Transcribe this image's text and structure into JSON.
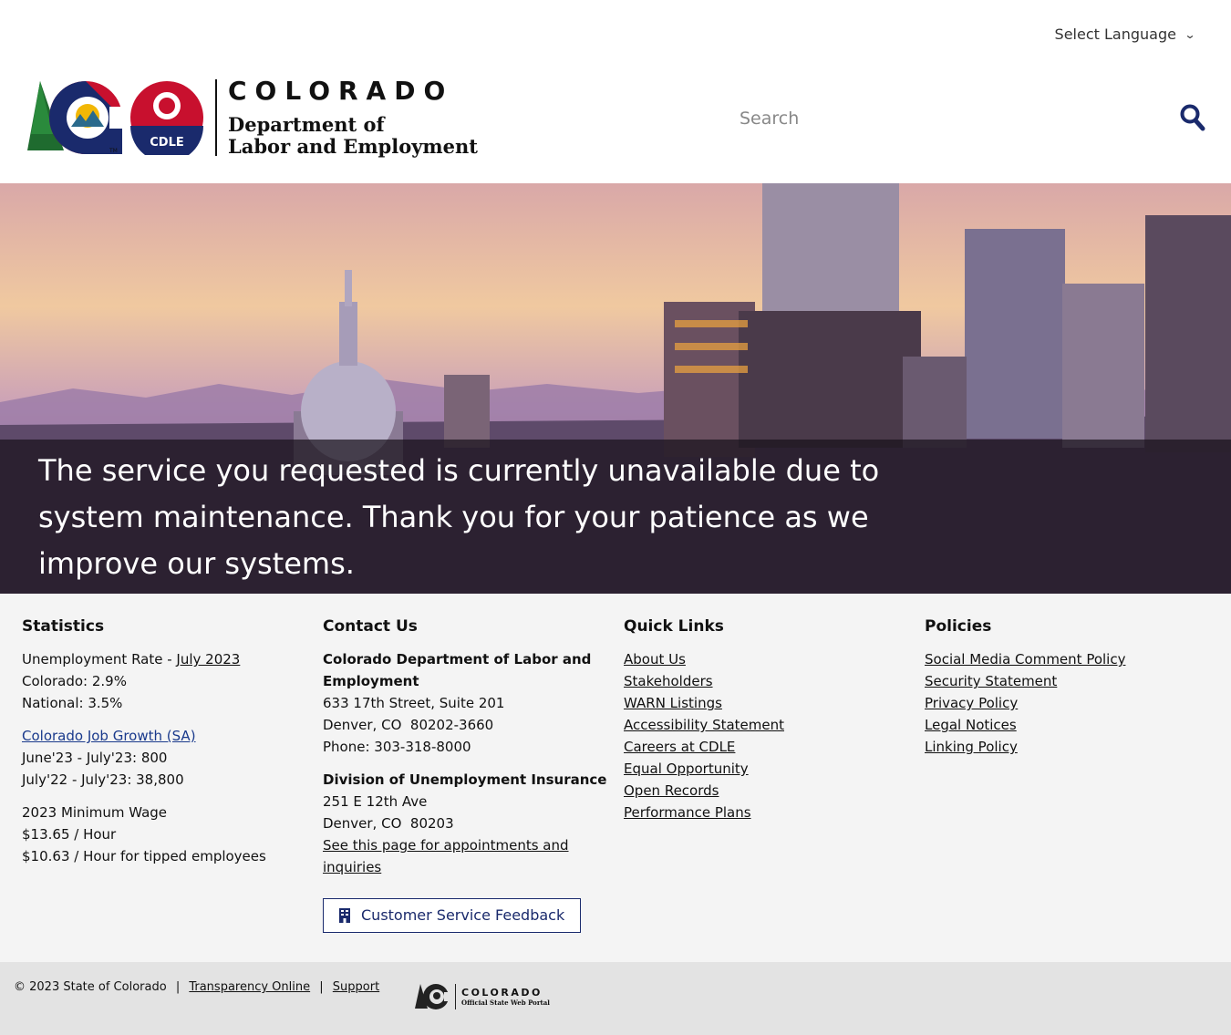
{
  "header": {
    "language_label": "Select Language",
    "logo": {
      "state": "COLORADO",
      "dept_line1": "Department of",
      "dept_line2": "Labor and Employment",
      "badge_text": "CDLE"
    },
    "search": {
      "placeholder": "Search"
    }
  },
  "hero": {
    "message": "The service you requested is currently unavailable due to system maintenance. Thank you for your patience as we improve our systems."
  },
  "statistics": {
    "heading": "Statistics",
    "unemployment_prefix": "Unemployment Rate - ",
    "unemployment_link": "July 2023",
    "colorado_rate": "Colorado: 2.9%",
    "national_rate": "National: 3.5%",
    "job_growth_link": "Colorado Job Growth (SA)",
    "job_growth_1": "June'23 - July'23: 800",
    "job_growth_2": "July'22 - July'23: 38,800",
    "min_wage_title": "2023 Minimum Wage",
    "min_wage_1": "$13.65 / Hour",
    "min_wage_2": "$10.63 / Hour for tipped employees"
  },
  "contact": {
    "heading": "Contact Us",
    "org1_name": "Colorado Department of Labor and Employment",
    "org1_address": "633 17th Street, Suite 201",
    "org1_city": "Denver, CO  80202-3660",
    "org1_phone": "Phone: 303-318-8000",
    "org2_name": "Division of Unemployment Insurance",
    "org2_address": "251 E 12th Ave",
    "org2_city": "Denver, CO  80203",
    "org2_link": "See this page for appointments and inquiries",
    "feedback_button": "Customer Service Feedback"
  },
  "quick_links": {
    "heading": "Quick Links",
    "items": [
      "About Us",
      "Stakeholders",
      "WARN Listings",
      "Accessibility Statement",
      "Careers at CDLE",
      "Equal Opportunity",
      "Open Records",
      "Performance Plans"
    ]
  },
  "policies": {
    "heading": "Policies",
    "items": [
      "Social Media Comment Policy",
      "Security Statement",
      "Privacy Policy",
      "Legal Notices",
      "Linking Policy"
    ]
  },
  "bottom": {
    "copyright": "© 2023 State of Colorado",
    "sep": "|",
    "transparency": "Transparency Online",
    "support": "Support",
    "portal_name": "COLORADO",
    "portal_sub": "Official State Web Portal"
  },
  "colors": {
    "brand_navy": "#1a2a6c",
    "brand_red": "#c8102e",
    "brand_gold": "#f2b705",
    "footer_bg": "#f4f4f4",
    "bottom_bg": "#e3e3e3"
  }
}
